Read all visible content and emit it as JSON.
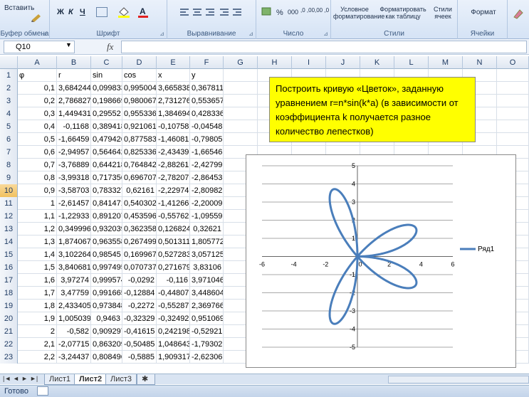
{
  "ribbon": {
    "clipboard": {
      "paste_label": "Вставить",
      "group_label": "Буфер обмена"
    },
    "font": {
      "group_label": "Шрифт",
      "bold": "Ж",
      "italic": "К",
      "underline": "Ч"
    },
    "alignment": {
      "group_label": "Выравнивание"
    },
    "number": {
      "group_label": "Число",
      "percent": "%",
      "thousands": "000",
      "inc_decimals": ",0 ,00",
      "dec_decimals": ",00 ,0"
    },
    "styles": {
      "group_label": "Стили",
      "conditional": "Условное форматирование",
      "as_table": "Форматировать как таблицу",
      "cell_styles": "Стили ячеек"
    },
    "cells": {
      "group_label": "Ячейки",
      "format": "Формат"
    }
  },
  "formula_bar": {
    "name_box": "Q10",
    "fx": "fx",
    "formula": ""
  },
  "columns": [
    "A",
    "B",
    "C",
    "D",
    "E",
    "F",
    "G",
    "H",
    "I",
    "J",
    "K",
    "L",
    "M",
    "N",
    "O"
  ],
  "selected_column": "Q",
  "selected_row": "10",
  "header_row": {
    "num": "1",
    "cells": [
      "φ",
      "r",
      "sin",
      "cos",
      "x",
      "y"
    ]
  },
  "rows": [
    {
      "num": "2",
      "cells": [
        "0,1",
        "3,684244",
        "0,099833",
        "0,995004",
        "3,665838",
        "0,367811"
      ]
    },
    {
      "num": "3",
      "cells": [
        "0,2",
        "2,786827",
        "0,198669",
        "0,980067",
        "2,731276",
        "0,553657"
      ]
    },
    {
      "num": "4",
      "cells": [
        "0,3",
        "1,449431",
        "0,29552",
        "0,955336",
        "1,384694",
        "0,428336"
      ]
    },
    {
      "num": "5",
      "cells": [
        "0,4",
        "-0,1168",
        "0,389418",
        "0,921061",
        "-0,10758",
        "-0,04548"
      ]
    },
    {
      "num": "6",
      "cells": [
        "0,5",
        "-1,66459",
        "0,479426",
        "0,877583",
        "-1,46081",
        "-0,79805"
      ]
    },
    {
      "num": "7",
      "cells": [
        "0,6",
        "-2,94957",
        "0,564642",
        "0,825336",
        "-2,43439",
        "-1,66546"
      ]
    },
    {
      "num": "8",
      "cells": [
        "0,7",
        "-3,76889",
        "0,644218",
        "0,764842",
        "-2,88261",
        "-2,42799"
      ]
    },
    {
      "num": "9",
      "cells": [
        "0,8",
        "-3,99318",
        "0,717356",
        "0,696707",
        "-2,78207",
        "-2,86453"
      ]
    },
    {
      "num": "10",
      "cells": [
        "0,9",
        "-3,58703",
        "0,783327",
        "0,62161",
        "-2,22974",
        "-2,80982"
      ]
    },
    {
      "num": "11",
      "cells": [
        "1",
        "-2,61457",
        "0,841471",
        "0,540302",
        "-1,41266",
        "-2,20009"
      ]
    },
    {
      "num": "12",
      "cells": [
        "1,1",
        "-1,22933",
        "0,891207",
        "0,453596",
        "-0,55762",
        "-1,09559"
      ]
    },
    {
      "num": "13",
      "cells": [
        "1,2",
        "0,349996",
        "0,932039",
        "0,362358",
        "0,126824",
        "0,32621"
      ]
    },
    {
      "num": "14",
      "cells": [
        "1,3",
        "1,874067",
        "0,963558",
        "0,267499",
        "0,501311",
        "1,805772"
      ]
    },
    {
      "num": "15",
      "cells": [
        "1,4",
        "3,102264",
        "0,98545",
        "0,169967",
        "0,527283",
        "3,057125"
      ]
    },
    {
      "num": "16",
      "cells": [
        "1,5",
        "3,840681",
        "0,997495",
        "0,070737",
        "0,271679",
        "3,83106"
      ]
    },
    {
      "num": "17",
      "cells": [
        "1,6",
        "3,97274",
        "0,999574",
        "-0,0292",
        "-0,116",
        "3,971046"
      ]
    },
    {
      "num": "18",
      "cells": [
        "1,7",
        "3,47759",
        "0,991665",
        "-0,12884",
        "-0,44807",
        "3,448604"
      ]
    },
    {
      "num": "19",
      "cells": [
        "1,8",
        "2,433405",
        "0,973848",
        "-0,2272",
        "-0,55287",
        "2,369766"
      ]
    },
    {
      "num": "20",
      "cells": [
        "1,9",
        "1,005039",
        "0,9463",
        "-0,32329",
        "-0,32492",
        "0,951069"
      ]
    },
    {
      "num": "21",
      "cells": [
        "2",
        "-0,582",
        "0,909297",
        "-0,41615",
        "0,242198",
        "-0,52921"
      ]
    },
    {
      "num": "22",
      "cells": [
        "2,1",
        "-2,07715",
        "0,863209",
        "-0,50485",
        "1,048643",
        "-1,79302"
      ]
    },
    {
      "num": "23",
      "cells": [
        "2,2",
        "-3,24437",
        "0,808496",
        "-0,5885",
        "1,909317",
        "-2,62306"
      ]
    }
  ],
  "note": "Построить кривую «Цветок», заданную уравнением  r=n*sin(k*a) (в зависимости от коэффициента k получается разное количество лепестков)",
  "chart_data": {
    "type": "scatter",
    "title": "",
    "xlabel": "",
    "ylabel": "",
    "xlim": [
      -6,
      6
    ],
    "ylim": [
      -5,
      5
    ],
    "x_ticks": [
      "-6",
      "-4",
      "-2",
      "0",
      "2",
      "4",
      "6"
    ],
    "y_ticks": [
      "5",
      "4",
      "3",
      "2",
      "1",
      "0",
      "-1",
      "-2",
      "-3",
      "-4",
      "-5"
    ],
    "grid": "horizontal",
    "legend": "right",
    "series": [
      {
        "name": "Ряд1",
        "color": "#4a7ebb",
        "curve": "rose",
        "r_max": 4,
        "k": 4,
        "line": true
      }
    ]
  },
  "sheets": {
    "nav": [
      "|◄",
      "◄",
      "►",
      "►|"
    ],
    "tabs": [
      "Лист1",
      "Лист2",
      "Лист3"
    ],
    "active": "Лист2"
  },
  "status": {
    "ready": "Готово"
  }
}
